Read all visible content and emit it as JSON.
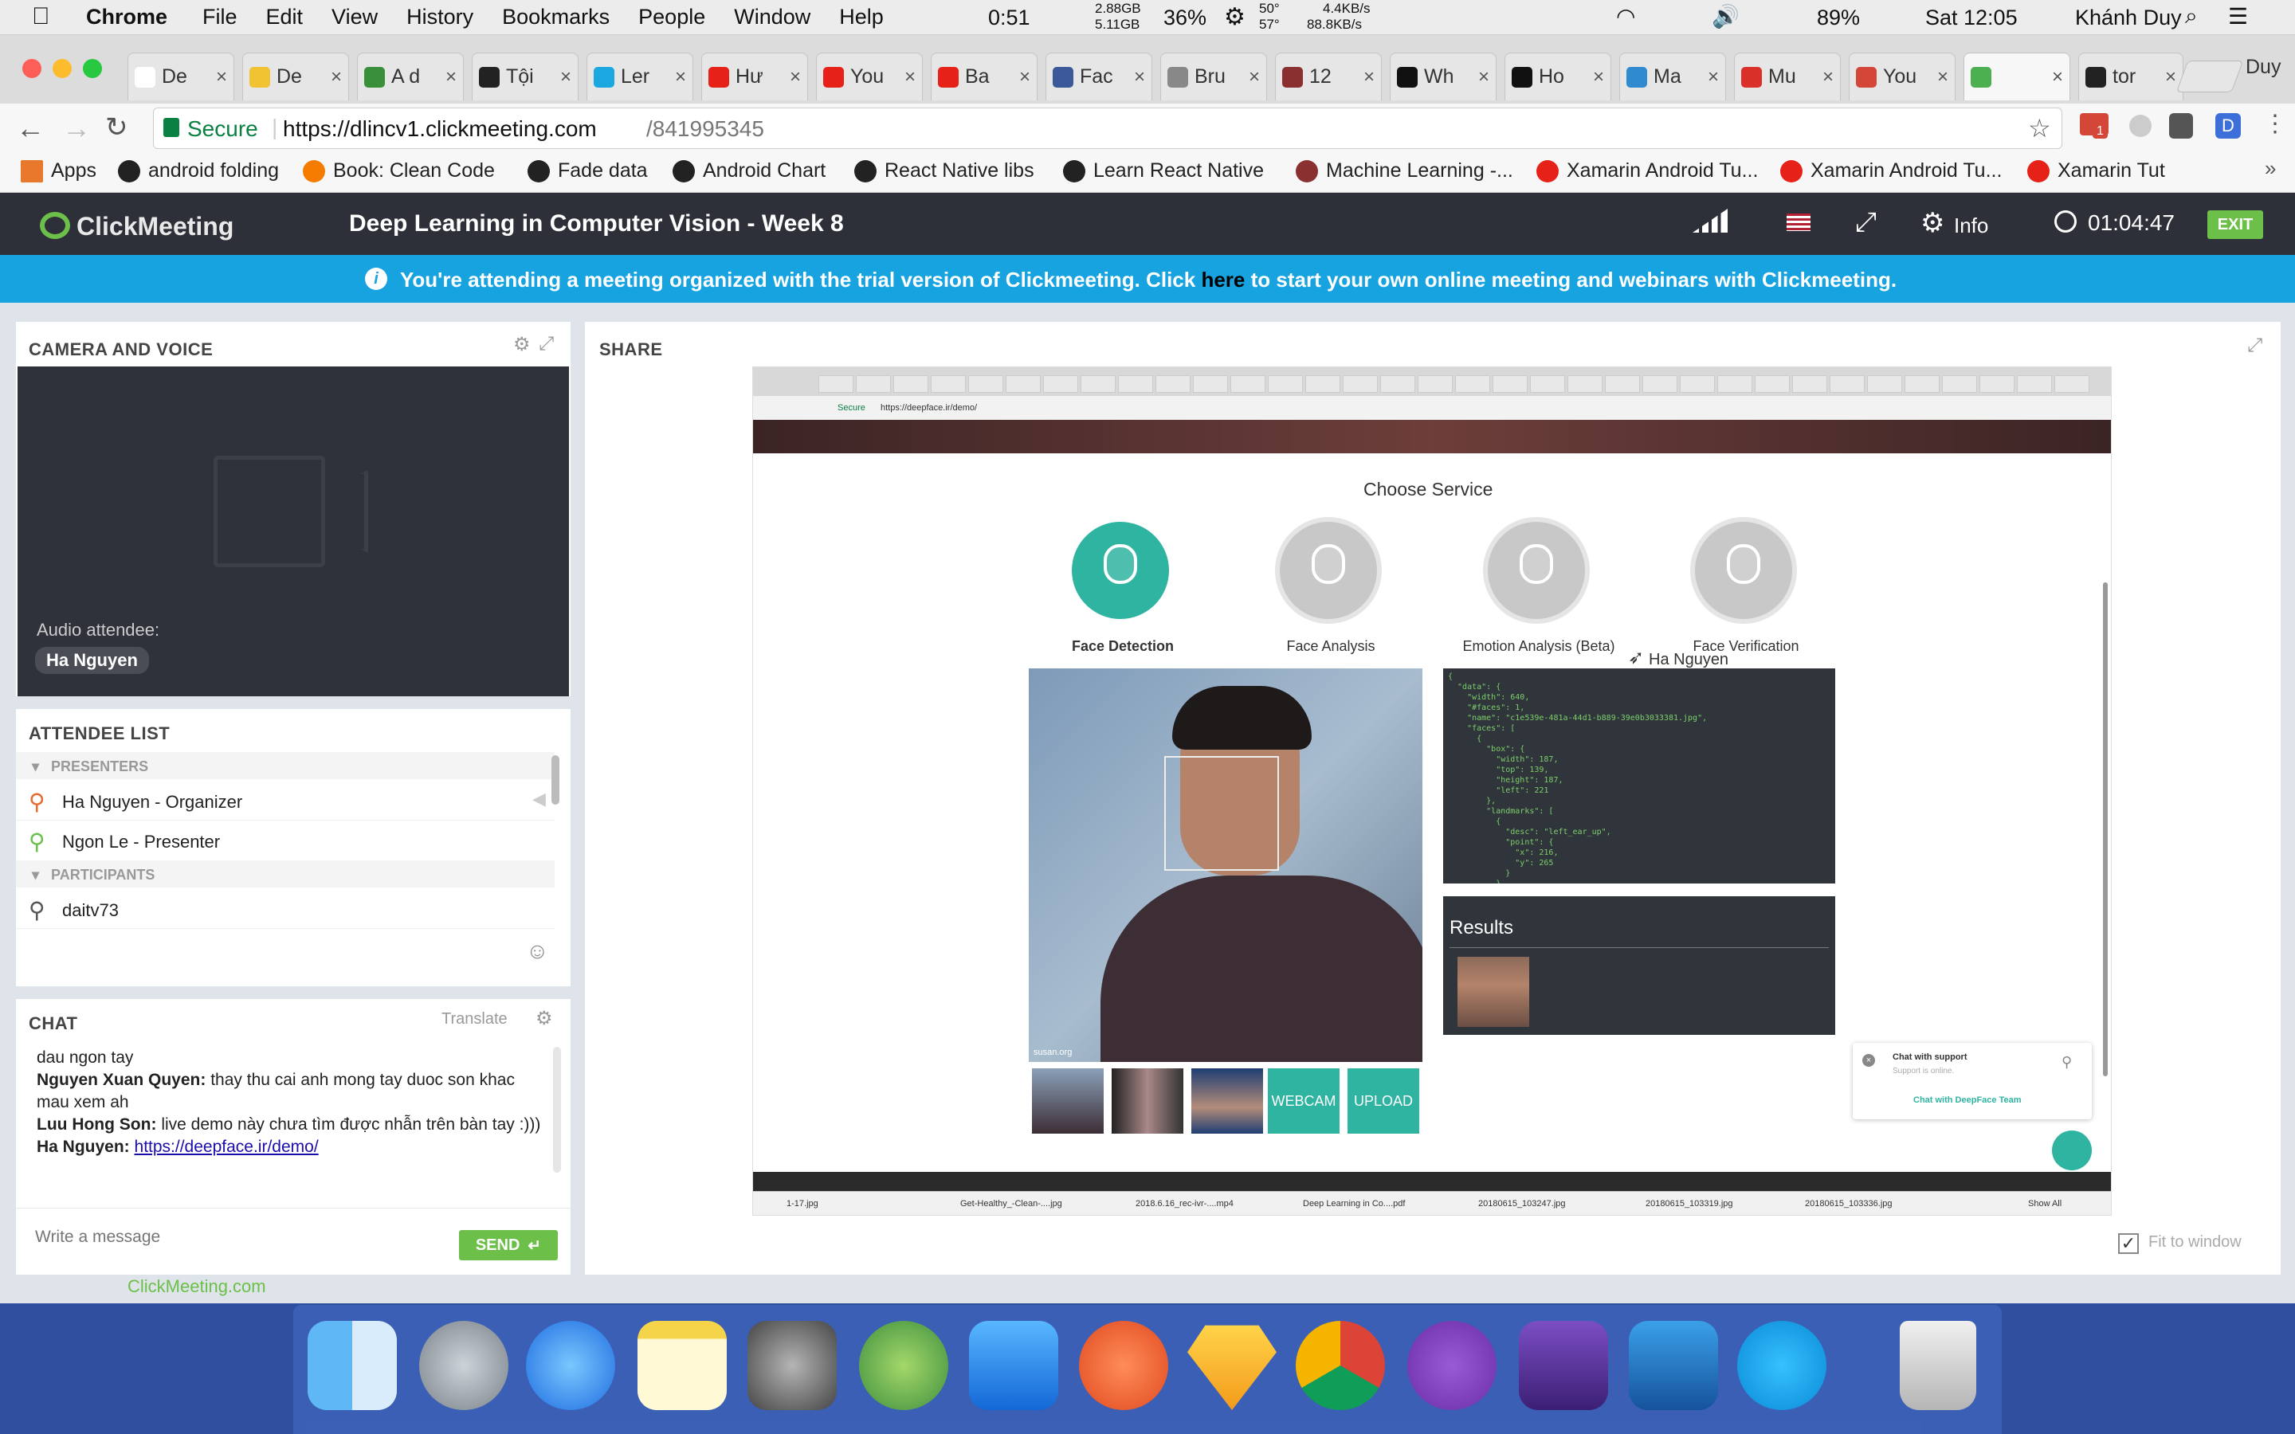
{
  "mac": {
    "app": "Chrome",
    "menus": [
      "File",
      "Edit",
      "View",
      "History",
      "Bookmarks",
      "People",
      "Window",
      "Help"
    ],
    "battery_time": "0:51",
    "mem_used": "2.88GB",
    "mem_total": "5.11GB",
    "cpu": "36%",
    "temp1": "50°",
    "temp2": "57°",
    "net_up": "4.4KB/s",
    "net_down": "88.8KB/s",
    "battery": "89%",
    "clock": "Sat 12:05",
    "user": "Khánh Duy"
  },
  "browser": {
    "profile": "Duy",
    "tabs": [
      {
        "label": "De",
        "color": "#ffffff"
      },
      {
        "label": "De",
        "color": "#f1c232"
      },
      {
        "label": "A d",
        "color": "#3a8f3a"
      },
      {
        "label": "Tội",
        "color": "#222222"
      },
      {
        "label": "Ler",
        "color": "#1ba8e0"
      },
      {
        "label": "Hư",
        "color": "#e62117"
      },
      {
        "label": "You",
        "color": "#e62117"
      },
      {
        "label": "Ba",
        "color": "#e62117"
      },
      {
        "label": "Fac",
        "color": "#3b5998"
      },
      {
        "label": "Bru",
        "color": "#888888"
      },
      {
        "label": "12",
        "color": "#8a3030"
      },
      {
        "label": "Wh",
        "color": "#111111"
      },
      {
        "label": "Ho",
        "color": "#111111"
      },
      {
        "label": "Ma",
        "color": "#2f8ad0"
      },
      {
        "label": "Mu",
        "color": "#d9302a"
      },
      {
        "label": "You",
        "color": "#d44638"
      },
      {
        "label": "",
        "color": "#4caf50"
      },
      {
        "label": "tor",
        "color": "#222222"
      }
    ],
    "secure_label": "Secure",
    "url_base": "https://dlincv1.clickmeeting.com",
    "url_path": "/841995345",
    "gmail_badge": "1",
    "bookmarks": [
      "Apps",
      "android folding",
      "Book: Clean Code",
      "Fade data",
      "Android Chart",
      "React Native libs",
      "Learn React Native",
      "Machine Learning -...",
      "Xamarin Android Tu...",
      "Xamarin Android Tu...",
      "Xamarin Tut"
    ]
  },
  "meeting": {
    "logo": "ClickMeeting",
    "title": "Deep Learning in Computer Vision - Week 8",
    "info_label": "Info",
    "timer": "01:04:47",
    "exit_label": "EXIT",
    "banner_pre": "You're attending a meeting organized with the trial version of Clickmeeting. Click",
    "banner_link": "here",
    "banner_post": "to start your own online meeting and webinars with Clickmeeting."
  },
  "camera": {
    "title": "CAMERA AND VOICE",
    "audio_label": "Audio attendee:",
    "attendee": "Ha Nguyen"
  },
  "attendees": {
    "title": "ATTENDEE LIST",
    "presenters_label": "PRESENTERS",
    "presenters": [
      "Ha Nguyen - Organizer",
      "Ngon Le - Presenter"
    ],
    "participants_label": "PARTICIPANTS",
    "participants": [
      "daitv73"
    ]
  },
  "chat": {
    "title": "CHAT",
    "translate": "Translate",
    "messages": [
      {
        "author": "",
        "text": "dau ngon tay"
      },
      {
        "author": "Nguyen Xuan Quyen:",
        "text": " thay thu cai anh mong tay duoc son khac mau xem ah"
      },
      {
        "author": "Luu Hong Son:",
        "text": " live demo này chưa tìm được nhẫn trên bàn tay :)))"
      },
      {
        "author": "Ha Nguyen:",
        "text": "",
        "link": "https://deepface.ir/demo/"
      }
    ],
    "placeholder": "Write a message",
    "send": "SEND",
    "powered_by": "ClickMeeting.com"
  },
  "share": {
    "title": "SHARE",
    "fit_label": "Fit to window",
    "inner_url_secure": "Secure",
    "inner_url": "https://deepface.ir/demo/",
    "choose_service": "Choose Service",
    "services": [
      {
        "label": "Face Detection",
        "active": true
      },
      {
        "label": "Face Analysis",
        "active": false
      },
      {
        "label": "Emotion Analysis (Beta)",
        "active": false
      },
      {
        "label": "Face Verification",
        "active": false
      }
    ],
    "cursor_name": "Ha Nguyen",
    "json_text": "{\n  \"data\": {\n    \"width\": 640,\n    \"#faces\": 1,\n    \"name\": \"c1e539e-481a-44d1-b889-39e0b3033381.jpg\",\n    \"faces\": [\n      {\n        \"box\": {\n          \"width\": 187,\n          \"top\": 139,\n          \"height\": 187,\n          \"left\": 221\n        },\n        \"landmarks\": [\n          {\n            \"desc\": \"left_ear_up\",\n            \"point\": {\n              \"x\": 216,\n              \"y\": 265\n            }\n          },",
    "results_title": "Results",
    "photo_credit": "susan.org",
    "webcam": "WEBCAM",
    "upload": "UPLOAD",
    "chat_support_title": "Chat with support",
    "chat_support_sub": "Support is online.",
    "chat_support_link": "Chat with DeepFace Team",
    "downloads": [
      "1-17.jpg",
      "Get-Healthy_-Clean-....jpg",
      "2018.6.16_rec-ivr-....mp4",
      "Deep Learning in Co....pdf",
      "20180615_103247.jpg",
      "20180615_103319.jpg",
      "20180615_103336.jpg"
    ],
    "show_all": "Show All"
  }
}
